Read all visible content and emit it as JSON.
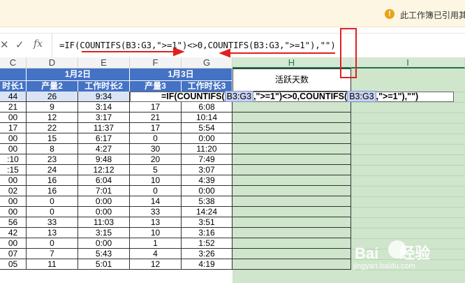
{
  "notice": {
    "text": "此工作簿已引用其"
  },
  "formula_bar": {
    "cancel_icon": "close-icon",
    "confirm_icon": "check-icon",
    "fx_label": "fx",
    "formula": "=IF(COUNTIFS(B3:G3,\">=1\")<>0,COUNTIFS(B3:G3,\">=1\"),\"\")"
  },
  "columns": [
    "C",
    "D",
    "E",
    "F",
    "G",
    "H",
    "I"
  ],
  "group_headers": {
    "d_e": "1月2日",
    "f_g": "1月3日"
  },
  "sub_headers": [
    "时长1",
    "产量2",
    "工作时长2",
    "产量3",
    "工作时长3"
  ],
  "h_header": "活跃天数",
  "active_formula": {
    "prefix": "=IF(COUNTIFS(",
    "ref1": "B3:G3",
    "middle": ",\">=1\")<>0,COUNTIFS(",
    "ref2": "B3:G3",
    "suffix": ",\">=1\"),\"\")"
  },
  "rows": [
    [
      "44",
      "26",
      "9:34",
      "",
      ""
    ],
    [
      "21",
      "9",
      "3:14",
      "17",
      "6:08"
    ],
    [
      "00",
      "12",
      "3:17",
      "21",
      "10:14"
    ],
    [
      "17",
      "22",
      "11:37",
      "17",
      "5:54"
    ],
    [
      "00",
      "15",
      "6:17",
      "0",
      "0:00"
    ],
    [
      "00",
      "8",
      "4:27",
      "30",
      "11:20"
    ],
    [
      ":10",
      "23",
      "9:48",
      "20",
      "7:49"
    ],
    [
      ":15",
      "24",
      "12:12",
      "5",
      "3:07"
    ],
    [
      "00",
      "16",
      "6:04",
      "10",
      "4:39"
    ],
    [
      "02",
      "16",
      "7:01",
      "0",
      "0:00"
    ],
    [
      "00",
      "0",
      "0:00",
      "14",
      "5:38"
    ],
    [
      "00",
      "0",
      "0:00",
      "33",
      "14:24"
    ],
    [
      "56",
      "33",
      "11:03",
      "13",
      "3:51"
    ],
    [
      "42",
      "13",
      "3:15",
      "10",
      "3:16"
    ],
    [
      "00",
      "0",
      "0:00",
      "1",
      "1:52"
    ],
    [
      "07",
      "7",
      "5:43",
      "4",
      "3:26"
    ],
    [
      "05",
      "11",
      "5:01",
      "12",
      "4:19"
    ]
  ],
  "watermark": {
    "brand": "Bai",
    "brand2": "经验",
    "url": "jingyan.baidu.com"
  },
  "colors": {
    "header_blue": "#4472c4",
    "selection_green": "#cfe5cc",
    "arrow_red": "#e02020"
  }
}
